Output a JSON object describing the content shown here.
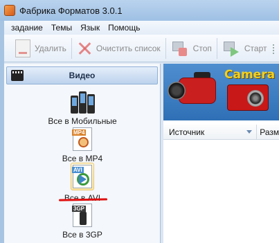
{
  "window": {
    "title": "Фабрика Форматов 3.0.1"
  },
  "menu": [
    "задание",
    "Темы",
    "Язык",
    "Помощь"
  ],
  "toolbar": {
    "delete_label": "Удалить",
    "clear_label": "Очистить список",
    "stop_label": "Стоп",
    "start_label": "Старт"
  },
  "sidebar": {
    "category": "Видео",
    "items": [
      {
        "label": "Все в Мобильные"
      },
      {
        "label": "Все в MP4",
        "tag": "MP4"
      },
      {
        "label": "Все в AVI",
        "tag": "AVI"
      },
      {
        "label": "Все в 3GP",
        "tag": "3GP"
      }
    ]
  },
  "banner": {
    "camera_text": "Camera"
  },
  "file_list": {
    "col_source": "Источник",
    "col_size": "Разм"
  },
  "colors": {
    "highlight_underline": "#e01010",
    "accent": "#2f6fb5"
  }
}
